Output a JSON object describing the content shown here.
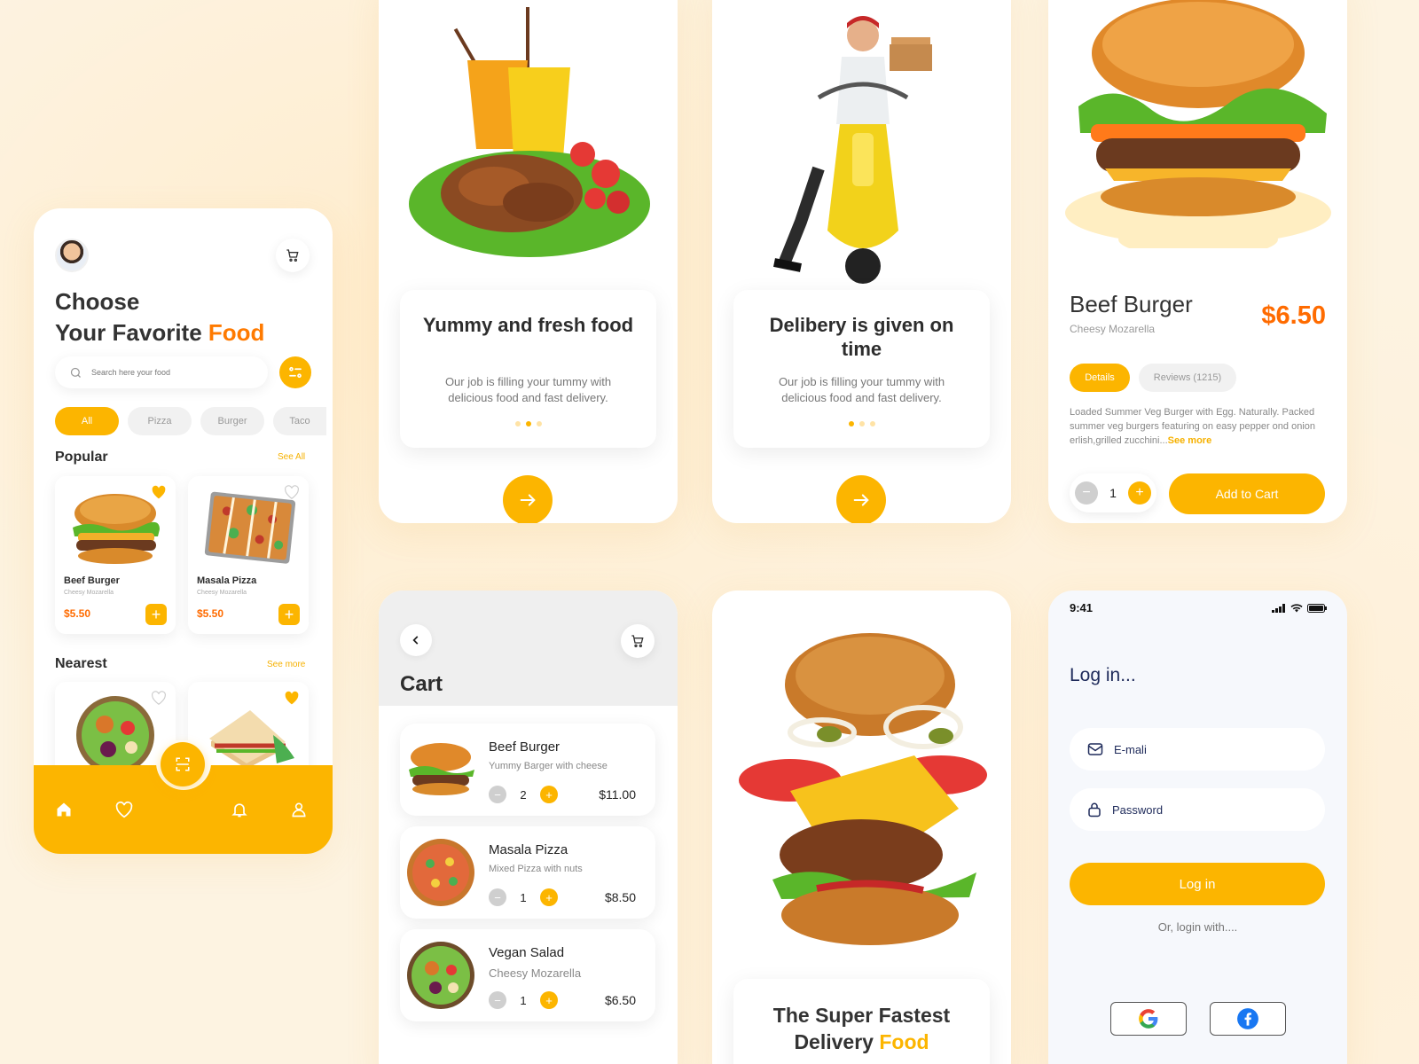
{
  "colors": {
    "accent": "#fcb500",
    "price": "#ff6b00",
    "text": "#2d2d2d",
    "navy": "#1e2a5a"
  },
  "home": {
    "title_line1": "Choose",
    "title_line2": "Your Favorite",
    "title_highlight": "Food",
    "search_placeholder": "Search here your food",
    "chips": [
      "All",
      "Pizza",
      "Burger",
      "Taco"
    ],
    "popular": {
      "heading": "Popular",
      "see_all": "See All",
      "items": [
        {
          "name": "Beef Burger",
          "sub": "Cheesy Mozarella",
          "price": "$5.50",
          "favorite": true
        },
        {
          "name": "Masala Pizza",
          "sub": "Cheesy Mozarella",
          "price": "$5.50",
          "favorite": false
        }
      ]
    },
    "nearest": {
      "heading": "Nearest",
      "see_more": "See more"
    }
  },
  "onboarding": [
    {
      "title": "Yummy and fresh food",
      "body": "Our job is filling your tummy with delicious food and fast delivery.",
      "active_dot": 1
    },
    {
      "title": "Delibery is given on time",
      "body": "Our job is filling your tummy with delicious food and fast delivery.",
      "active_dot": 0
    }
  ],
  "detail": {
    "name": "Beef Burger",
    "sub": "Cheesy Mozarella",
    "price": "$6.50",
    "tab_details": "Details",
    "tab_reviews": "Reviews (1215)",
    "description": "Loaded Summer Veg Burger with Egg. Naturally. Packed summer veg burgers featuring on easy pepper ond onion erlish,grilled zucchini...",
    "see_more": "See more",
    "quantity": "1",
    "add_to_cart": "Add to Cart"
  },
  "cart": {
    "title": "Cart",
    "items": [
      {
        "name": "Beef Burger",
        "desc": "Yummy Barger with cheese",
        "qty": "2",
        "price": "$11.00"
      },
      {
        "name": "Masala Pizza",
        "desc": "Mixed Pizza with nuts",
        "qty": "1",
        "price": "$8.50"
      },
      {
        "name": "Vegan Salad",
        "desc": "Cheesy Mozarella",
        "qty": "1",
        "price": "$6.50"
      }
    ]
  },
  "promo": {
    "line1": "The Super Fastest",
    "line2": "Delivery",
    "highlight": "Food"
  },
  "login": {
    "time": "9:41",
    "title": "Log in...",
    "email_placeholder": "E-mali",
    "password_placeholder": "Password",
    "button": "Log in",
    "or_text": "Or, login with...."
  }
}
